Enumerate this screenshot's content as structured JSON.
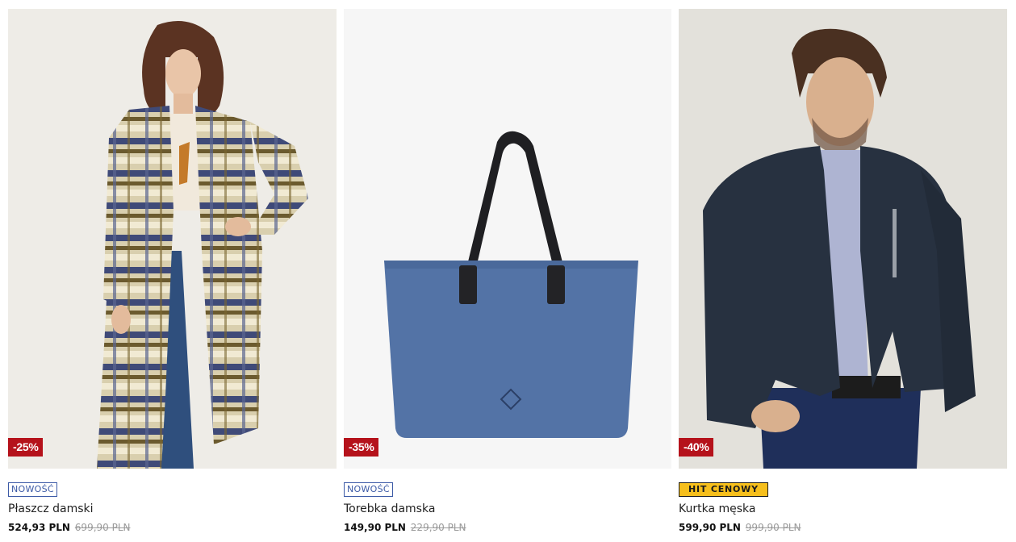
{
  "products": [
    {
      "name": "Płaszcz damski",
      "price": "524,93 PLN",
      "old_price": "699,90 PLN",
      "discount": "-25%",
      "tag": "NOWOŚĆ",
      "tag_type": "new"
    },
    {
      "name": "Torebka damska",
      "price": "149,90 PLN",
      "old_price": "229,90 PLN",
      "discount": "-35%",
      "tag": "NOWOŚĆ",
      "tag_type": "new"
    },
    {
      "name": "Kurtka męska",
      "price": "599,90 PLN",
      "old_price": "999,90 PLN",
      "discount": "-40%",
      "tag": "HIT CENOWY",
      "tag_type": "hit"
    }
  ],
  "colors": {
    "discount_badge": "#b5121b",
    "new_tag": "#3c5aa6",
    "hit_tag": "#f6bf1c"
  }
}
